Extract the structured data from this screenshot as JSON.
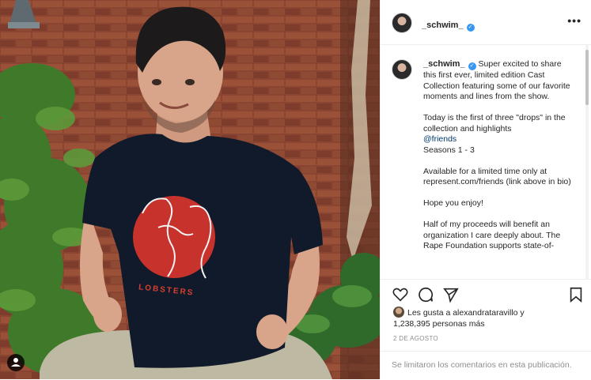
{
  "post": {
    "author": "_schwim_",
    "caption": [
      "Super excited to share this first ever, limited edition Cast Collection featuring some of our favorite moments and lines from the show.",
      "Today is the first of three \"drops\" in the collection and highlights",
      "Available for a limited time only at represent.com/friends (link above in bio)",
      "Hope you enjoy!",
      "Half of my proceeds will benefit an organization I care deeply about. The Rape Foundation supports state-of-"
    ],
    "mention": "@friends",
    "seasons": "Seasons 1 - 3",
    "shirt_text": "LOBSTERS"
  },
  "likes": {
    "line1": "Les gusta a alexandrataravillo y",
    "line2": "1,238,395 personas más"
  },
  "date": "2 DE AGOSTO",
  "comments_closed": "Se limitaron los comentarios en esta publicación.",
  "icons": {
    "more": "more-horizontal-icon",
    "like": "heart-icon",
    "comment": "comment-icon",
    "share": "send-icon",
    "save": "bookmark-icon",
    "tag": "user-tag-icon"
  },
  "colors": {
    "verified": "#3897f0",
    "shirt": "#111a2a",
    "shirt_circle": "#c8322c",
    "brick": "#7a3a2a"
  }
}
